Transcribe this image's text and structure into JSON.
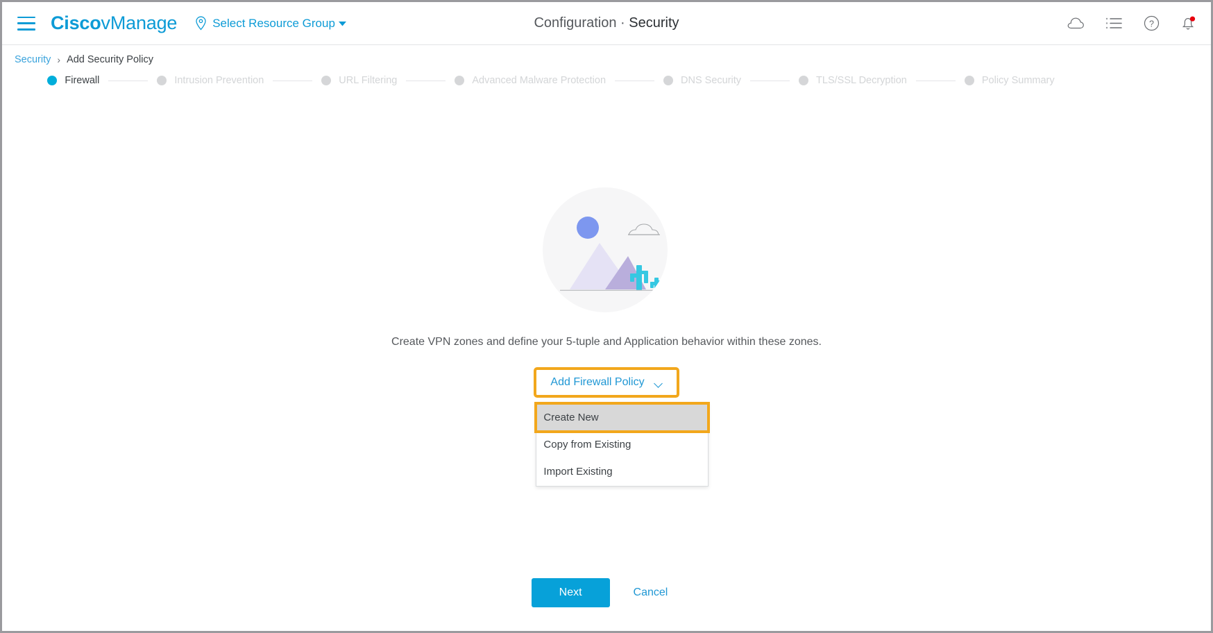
{
  "header": {
    "menu_icon": "hamburger-menu-icon",
    "brand_bold": "Cisco",
    "brand_light": "vManage",
    "resource_group_icon": "location-pin-icon",
    "resource_group_label": "Select Resource Group",
    "title_prefix": "Configuration",
    "title_separator": "·",
    "title_suffix": "Security",
    "icons": [
      {
        "name": "cloud-icon"
      },
      {
        "name": "tasks-list-icon"
      },
      {
        "name": "help-circle-icon"
      },
      {
        "name": "notifications-bell-icon",
        "has_badge": true
      }
    ],
    "accent_color": "#0d9bd6"
  },
  "breadcrumb": {
    "root": "Security",
    "separator": "›",
    "current": "Add Security Policy"
  },
  "stepper": {
    "active_index": 0,
    "active_color": "#00aedb",
    "inactive_color": "#d5d6d8",
    "steps": [
      {
        "label": "Firewall"
      },
      {
        "label": "Intrusion Prevention"
      },
      {
        "label": "URL Filtering"
      },
      {
        "label": "Advanced Malware Protection"
      },
      {
        "label": "DNS Security"
      },
      {
        "label": "TLS/SSL Decryption"
      },
      {
        "label": "Policy Summary"
      }
    ]
  },
  "main": {
    "illustration_name": "empty-state-landscape-illustration",
    "description": "Create VPN zones and define your 5-tuple and Application behavior within these zones.",
    "dropdown": {
      "button_label": "Add Firewall Policy",
      "chevron_icon": "chevron-down-icon",
      "highlight_color": "#f2a71c",
      "open": true,
      "items": [
        {
          "label": "Create New",
          "selected": true
        },
        {
          "label": "Copy from Existing",
          "selected": false
        },
        {
          "label": "Import Existing",
          "selected": false
        }
      ]
    }
  },
  "footer": {
    "next_label": "Next",
    "cancel_label": "Cancel",
    "primary_color": "#07a1d9"
  }
}
